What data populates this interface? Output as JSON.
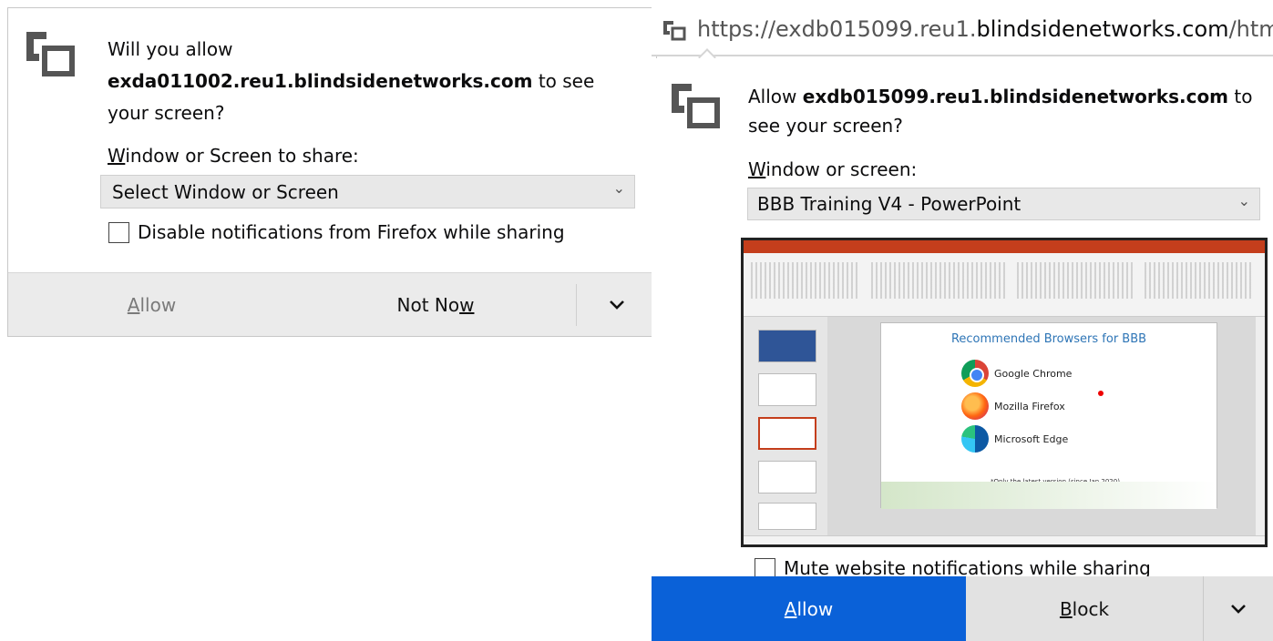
{
  "panel_old": {
    "prompt_before": "Will you allow",
    "prompt_host": "exda011002.reu1.blindsidenetworks.com",
    "prompt_after": " to see your screen?",
    "select_label_u": "W",
    "select_label_rest": "indow or Screen to share:",
    "select_value": "Select Window or Screen",
    "checkbox_label": "Disable notifications from Firefox while sharing",
    "allow_u": "A",
    "allow_rest": "llow",
    "notnow_pre": "Not No",
    "notnow_u": "w"
  },
  "url_bar": {
    "url_prefix": "https://exdb015099.reu1.",
    "url_domain": "blindsidenetworks.com",
    "url_suffix": "/htm"
  },
  "panel_new": {
    "prompt_before": "Allow ",
    "prompt_host": "exdb015099.reu1.blindsidenetworks.com",
    "prompt_after": " to see your screen?",
    "select_label_u": "W",
    "select_label_rest": "indow or screen:",
    "select_value": "BBB Training V4 - PowerPoint",
    "checkbox_label": "Mute website notifications while sharing",
    "allow_u": "A",
    "allow_rest": "llow",
    "block_u": "B",
    "block_rest": "lock"
  },
  "preview": {
    "slide_title": "Recommended Browsers for BBB",
    "browsers": [
      "Google Chrome",
      "Mozilla Firefox",
      "Microsoft Edge"
    ],
    "note": "*Only the latest version (since Jan 2020)"
  },
  "colors": {
    "allow_blue": "#0a61d8",
    "powerpoint_red": "#c43e1c",
    "slide_title_blue": "#2e75b6"
  },
  "icons": [
    "screen-share-icon",
    "chevron-down-icon",
    "checkbox-icon"
  ]
}
